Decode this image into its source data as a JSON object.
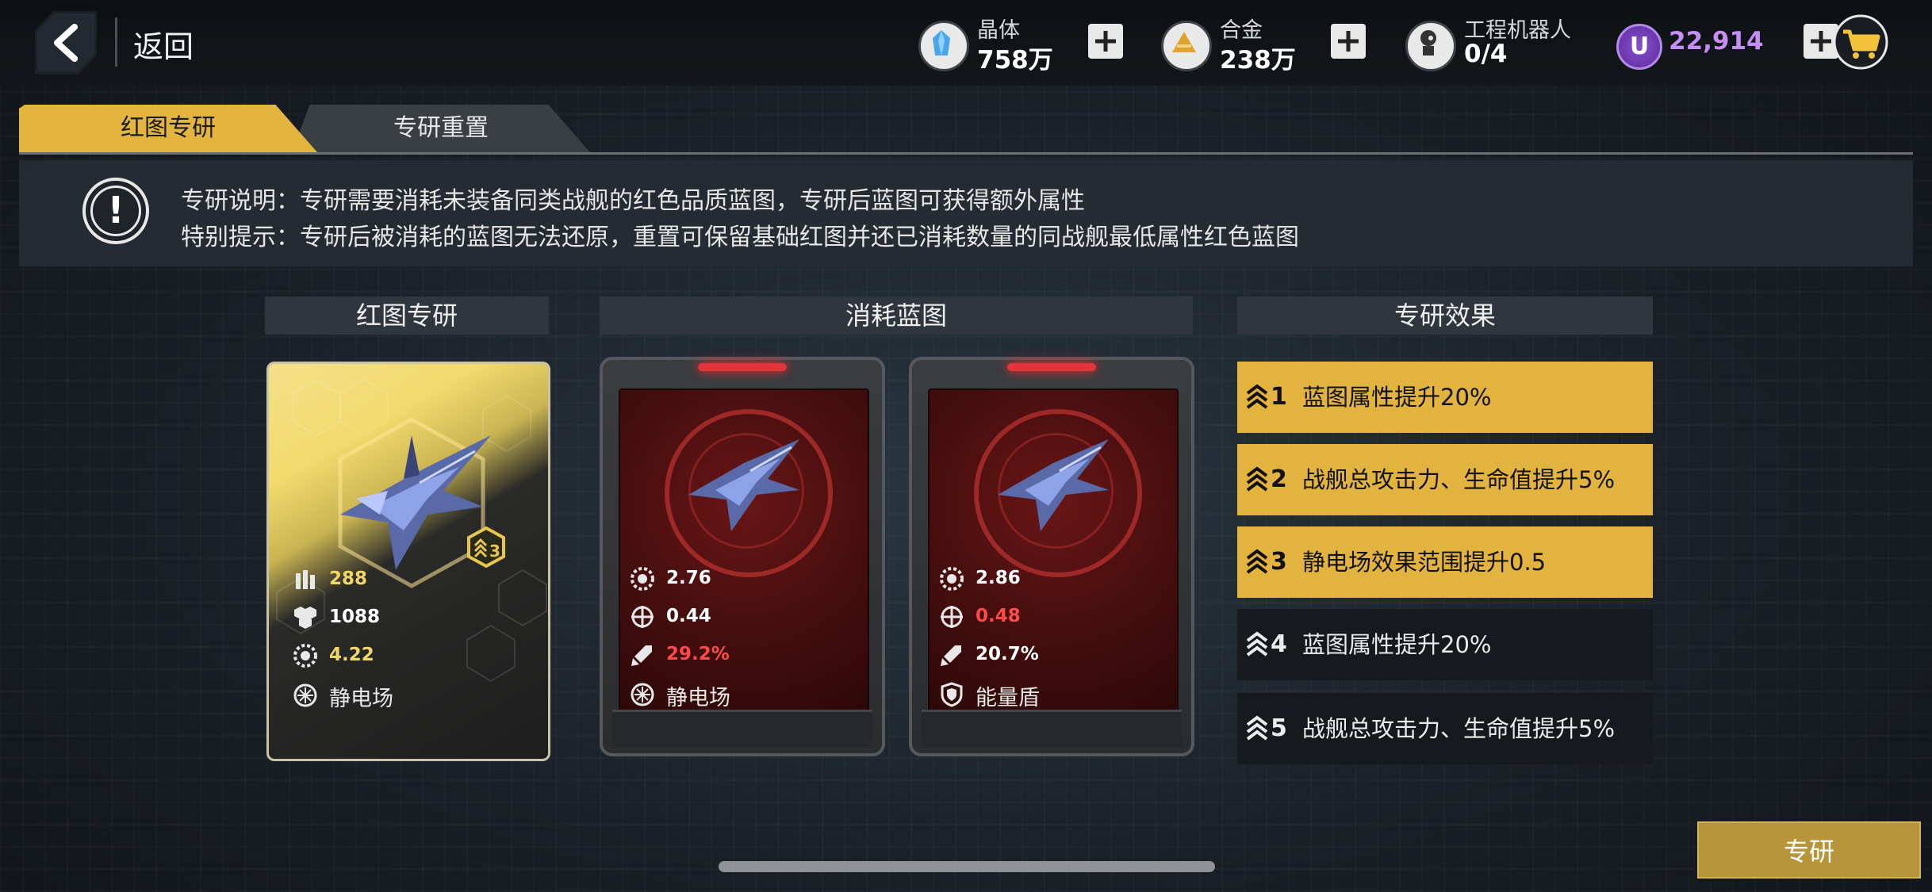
{
  "header": {
    "back_label": "返回",
    "resources": [
      {
        "name": "晶体",
        "value": "758万",
        "icon": "crystal-icon"
      },
      {
        "name": "合金",
        "value": "238万",
        "icon": "alloy-icon"
      },
      {
        "name": "工程机器人",
        "value": "0/4",
        "icon": "robot-icon"
      }
    ],
    "premium": {
      "symbol": "U",
      "value": "22,914",
      "color": "#c58ef5"
    }
  },
  "tabs": [
    {
      "label": "红图专研",
      "active": true
    },
    {
      "label": "专研重置",
      "active": false
    }
  ],
  "notice": {
    "line1": "专研说明：专研需要消耗未装备同类战舰的红色品质蓝图，专研后蓝图可获得额外属性",
    "line2": "特别提示：专研后被消耗的蓝图无法还原，重置可保留基础红图并还已消耗数量的同战舰最低属性红色蓝图"
  },
  "sections": {
    "red_blueprint": "红图专研",
    "consumed": "消耗蓝图",
    "effects": "专研效果"
  },
  "main_card": {
    "level": "3",
    "stats": [
      {
        "icon": "ammo-icon",
        "value": "288",
        "color": "#f2d86a"
      },
      {
        "icon": "hull-icon",
        "value": "1088",
        "color": "#ffffff"
      },
      {
        "icon": "rate-icon",
        "value": "4.22",
        "color": "#f2d86a"
      }
    ],
    "skill": "静电场"
  },
  "consumed_cards": [
    {
      "stats": [
        {
          "icon": "rate-icon",
          "value": "2.76",
          "color": "#ffffff"
        },
        {
          "icon": "target-icon",
          "value": "0.44",
          "color": "#ffffff"
        },
        {
          "icon": "missile-icon",
          "value": "29.2%",
          "color": "#ff4a4a"
        }
      ],
      "skill": "静电场"
    },
    {
      "stats": [
        {
          "icon": "rate-icon",
          "value": "2.86",
          "color": "#ffffff"
        },
        {
          "icon": "target-icon",
          "value": "0.48",
          "color": "#ff4a4a"
        },
        {
          "icon": "missile-icon",
          "value": "20.7%",
          "color": "#ffffff"
        }
      ],
      "skill": "能量盾"
    }
  ],
  "effects": [
    {
      "level": "1",
      "text": "蓝图属性提升20%",
      "unlocked": true
    },
    {
      "level": "2",
      "text": "战舰总攻击力、生命值提升5%",
      "unlocked": true
    },
    {
      "level": "3",
      "text": "静电场效果范围提升0.5",
      "unlocked": true
    },
    {
      "level": "4",
      "text": "蓝图属性提升20%",
      "unlocked": false
    },
    {
      "level": "5",
      "text": "战舰总攻击力、生命值提升5%",
      "unlocked": false
    }
  ],
  "research_button": "专研",
  "colors": {
    "accent": "#e2b33f",
    "red": "#ff4a4a",
    "panel": "#2f363d"
  }
}
